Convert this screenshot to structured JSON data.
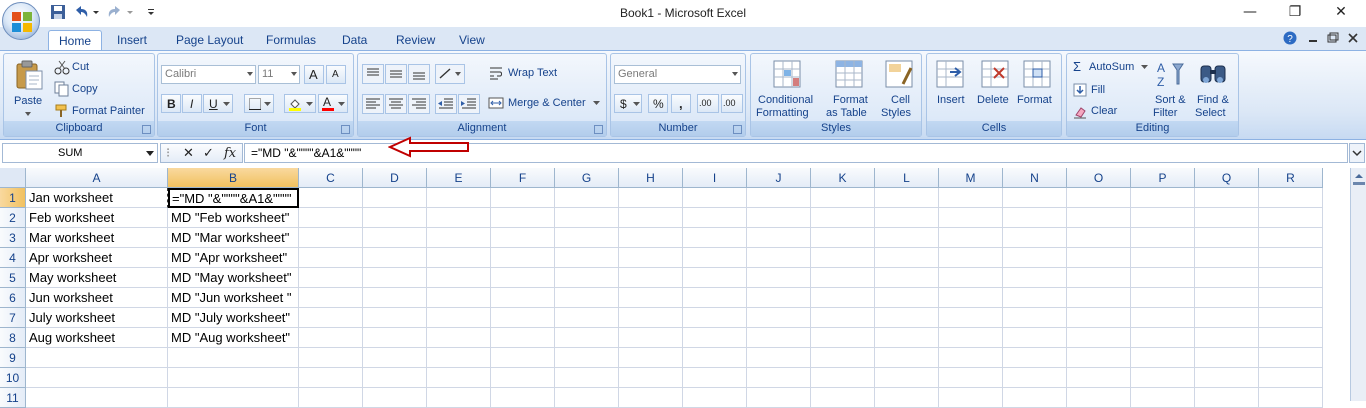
{
  "window": {
    "title": "Book1 - Microsoft Excel",
    "minimize": "—",
    "restore": "❐",
    "close": "✕"
  },
  "tabs": [
    {
      "label": "Home",
      "active": true
    },
    {
      "label": "Insert"
    },
    {
      "label": "Page Layout"
    },
    {
      "label": "Formulas"
    },
    {
      "label": "Data"
    },
    {
      "label": "Review"
    },
    {
      "label": "View"
    }
  ],
  "ribbon": {
    "clipboard": {
      "label": "Clipboard",
      "paste": "Paste",
      "cut": "Cut",
      "copy": "Copy",
      "format_painter": "Format Painter"
    },
    "font": {
      "label": "Font",
      "font_name": "Calibri",
      "font_size": "11",
      "bold": "B",
      "italic": "I",
      "underline": "U",
      "grow": "A",
      "shrink": "A",
      "font_color": "A"
    },
    "alignment": {
      "label": "Alignment",
      "wrap_text": "Wrap Text",
      "merge_center": "Merge & Center"
    },
    "number": {
      "label": "Number",
      "format": "General",
      "currency": "$",
      "percent": "%",
      "comma": ",",
      "inc_decimal": ".00",
      "dec_decimal": ".00"
    },
    "styles": {
      "label": "Styles",
      "conditional_1": "Conditional",
      "conditional_2": "Formatting",
      "format_table_1": "Format",
      "format_table_2": "as Table",
      "cell_styles_1": "Cell",
      "cell_styles_2": "Styles"
    },
    "cells": {
      "label": "Cells",
      "insert": "Insert",
      "delete": "Delete",
      "format": "Format"
    },
    "editing": {
      "label": "Editing",
      "autosum": "AutoSum",
      "fill": "Fill",
      "clear": "Clear",
      "sort_1": "Sort &",
      "sort_2": "Filter",
      "find_1": "Find &",
      "find_2": "Select"
    }
  },
  "formula_bar": {
    "name_box": "SUM",
    "cancel": "✕",
    "enter": "✓",
    "fx": "fx",
    "formula": "=\"MD \"&\"\"\"\"&A1&\"\"\"\""
  },
  "sheet": {
    "columns": [
      "A",
      "B",
      "C",
      "D",
      "E",
      "F",
      "G",
      "H",
      "I",
      "J",
      "K",
      "L",
      "M",
      "N",
      "O",
      "P",
      "Q",
      "R"
    ],
    "rows": [
      "1",
      "2",
      "3",
      "4",
      "5",
      "6",
      "7",
      "8",
      "9",
      "10",
      "11"
    ],
    "col_a": [
      "Jan worksheet",
      "Feb worksheet",
      "Mar worksheet",
      "Apr worksheet",
      "May worksheet",
      "Jun worksheet",
      "July worksheet",
      "Aug worksheet"
    ],
    "col_b": [
      "=\"MD \"&\"\"\"\"&A1&\"\"\"\"",
      "MD \"Feb worksheet\"",
      "MD \"Mar worksheet\"",
      "MD \"Apr worksheet\"",
      "MD \"May worksheet\"",
      "MD \"Jun worksheet \"",
      "MD \"July worksheet\"",
      "MD \"Aug worksheet\""
    ]
  },
  "colors": {
    "accent": "#15428b",
    "annotation_arrow": "#c00000",
    "selected_header": "#f1c15f"
  }
}
